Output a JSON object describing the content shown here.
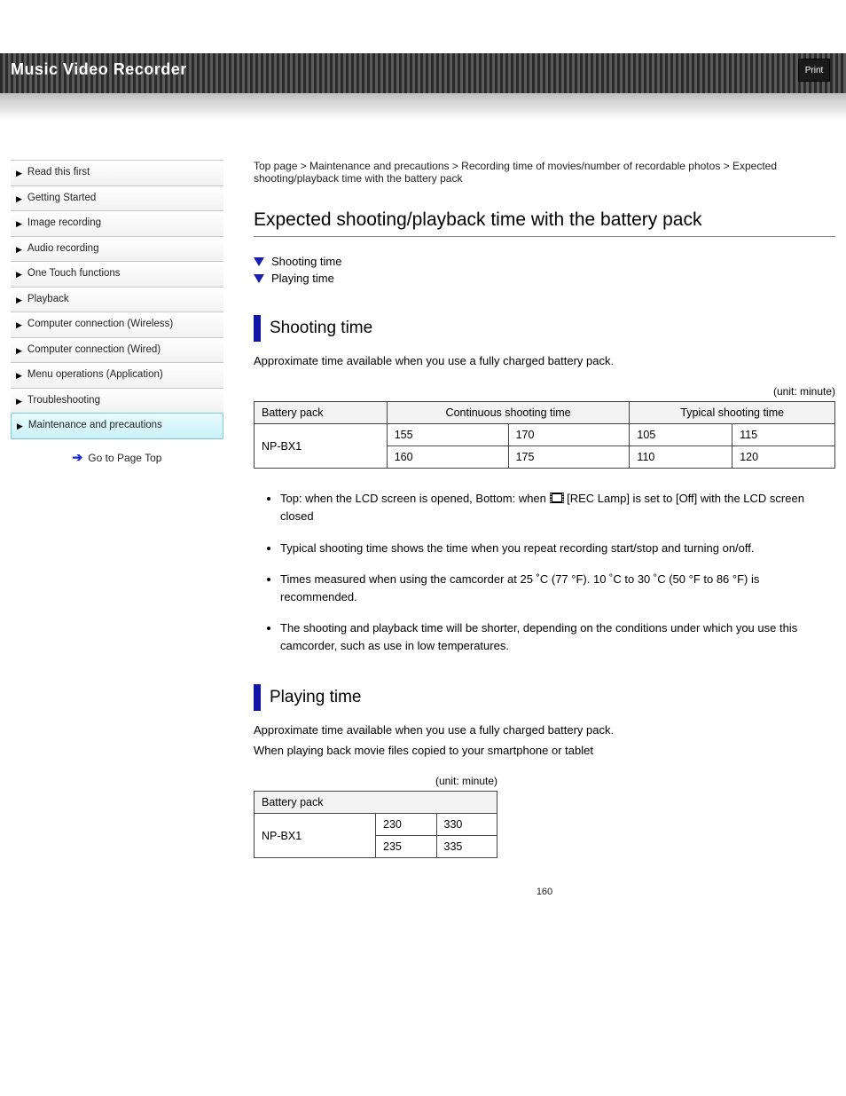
{
  "header": {
    "title": "Music Video Recorder",
    "print": "Print"
  },
  "sidebar": {
    "items": [
      {
        "label": "Read this first"
      },
      {
        "label": "Getting Started"
      },
      {
        "label": "Image recording"
      },
      {
        "label": "Audio recording"
      },
      {
        "label": "One Touch functions"
      },
      {
        "label": "Playback"
      },
      {
        "label": "Computer connection (Wireless)"
      },
      {
        "label": "Computer connection (Wired)"
      },
      {
        "label": "Menu operations (Application)"
      },
      {
        "label": "Troubleshooting"
      },
      {
        "label": "Maintenance and precautions"
      }
    ],
    "active_index": 10,
    "bottom_link": "Go to Page Top"
  },
  "breadcrumb": "Top page > Maintenance and precautions > Recording time of movies/number of recordable photos > Expected shooting/playback time with the battery pack",
  "page_title": "Expected shooting/playback time with the battery pack",
  "anchors": {
    "a1": "Shooting time",
    "a2": "Playing time"
  },
  "section1": {
    "heading": "Shooting time",
    "sub": "Approximate time available when you use a fully charged battery pack.",
    "unit": "(unit: minute)"
  },
  "table1": {
    "head": {
      "c1": "Battery pack",
      "c2": "Continuous shooting time",
      "c3": "Typical shooting time"
    },
    "rows": [
      {
        "bp": "NP-BX1",
        "c2a": "155",
        "c2b": "170",
        "c3a": "105",
        "c3b": "115"
      },
      {
        "bp": "",
        "c2a": "160",
        "c2b": "175",
        "c3a": "110",
        "c3b": "120"
      }
    ]
  },
  "notes": [
    {
      "pre": "Top: when the LCD screen is opened, Bottom: when ",
      "mid": " [REC Lamp] is set to [Off] with the LCD screen closed",
      "icon": "film"
    },
    {
      "text": "Typical shooting time shows the time when you repeat recording start/stop and turning on/off."
    },
    {
      "text": "Times measured when using the camcorder at 25 ˚C (77 °F). 10 ˚C to 30 ˚C (50 °F to 86 °F) is recommended."
    },
    {
      "text": "The shooting and playback time will be shorter, depending on the conditions under which you use this camcorder, such as use in low temperatures."
    }
  ],
  "section2": {
    "heading": "Playing time",
    "sub1": "Approximate time available when you use a fully charged battery pack.",
    "sub2": "When playing back movie files copied to your smartphone or tablet",
    "unit": "(unit: minute)"
  },
  "table2": {
    "head": {
      "c1": "Battery pack"
    },
    "rows": [
      {
        "bp": "NP-BX1",
        "v1": "230",
        "v2": "330"
      },
      {
        "bp": "",
        "v1": "235",
        "v2": "335"
      }
    ]
  },
  "page_number": "160"
}
